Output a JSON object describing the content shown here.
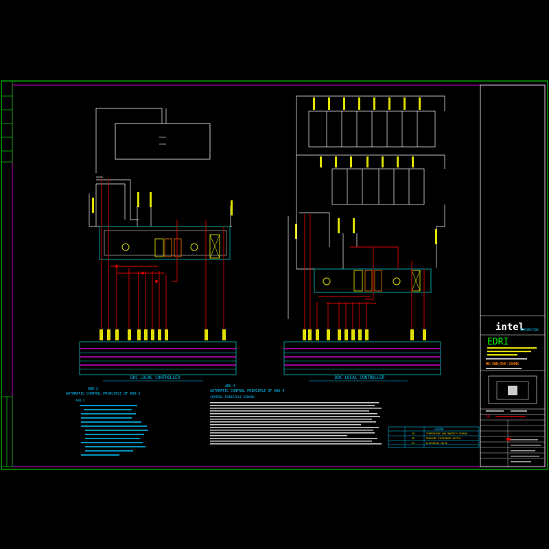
{
  "colors": {
    "background": "#000000",
    "frame": "#00c800",
    "sheet_border": "#c800c8",
    "line": "#ffffff",
    "signal": "#e00000",
    "bus": "#c800c8",
    "bus_base": "#00c8c8",
    "device": "#e0e000",
    "note_text": "#00c8ff",
    "accent_green": "#00ff00",
    "accent_orange": "#ff8000"
  },
  "left_panel": {
    "controller_title": "DDC LOCAL CONTROLLER",
    "heading_cn": "AHU-2",
    "heading_en": "AUTOMATIC CONTROL PRINCIPLE OF AHU-2",
    "notes_heading": "AHU-2",
    "notes": [
      "1.",
      "2.",
      "3.",
      "4.",
      "5.",
      "6.",
      "7.",
      "8.",
      "9."
    ]
  },
  "right_panel": {
    "controller_title": "DDC LOCAL CONTROLLER",
    "heading_cn": "AHU-4",
    "heading_en": "AUTOMATIC CONTROL PRINCIPLE OF AHU-4",
    "remark_heading": "CONTROL PRINCIPLE REMARK"
  },
  "legend": {
    "title": "LEGEND",
    "rows": [
      {
        "symbol": "TH",
        "desc": "TEMPERATURE AND HUMIDITY SENSOR"
      },
      {
        "symbol": "DP",
        "desc": "PRESSURE DIFFERENCE SWITCH"
      },
      {
        "symbol": "EV",
        "desc": "ELECTRICAL VALVE"
      }
    ]
  },
  "title_block": {
    "logo": "intel",
    "logo_sub": "CORPORATION",
    "firm": "EDRI",
    "drawing_number": "ME/SBM/PHF-204MS",
    "project": "CD"
  }
}
